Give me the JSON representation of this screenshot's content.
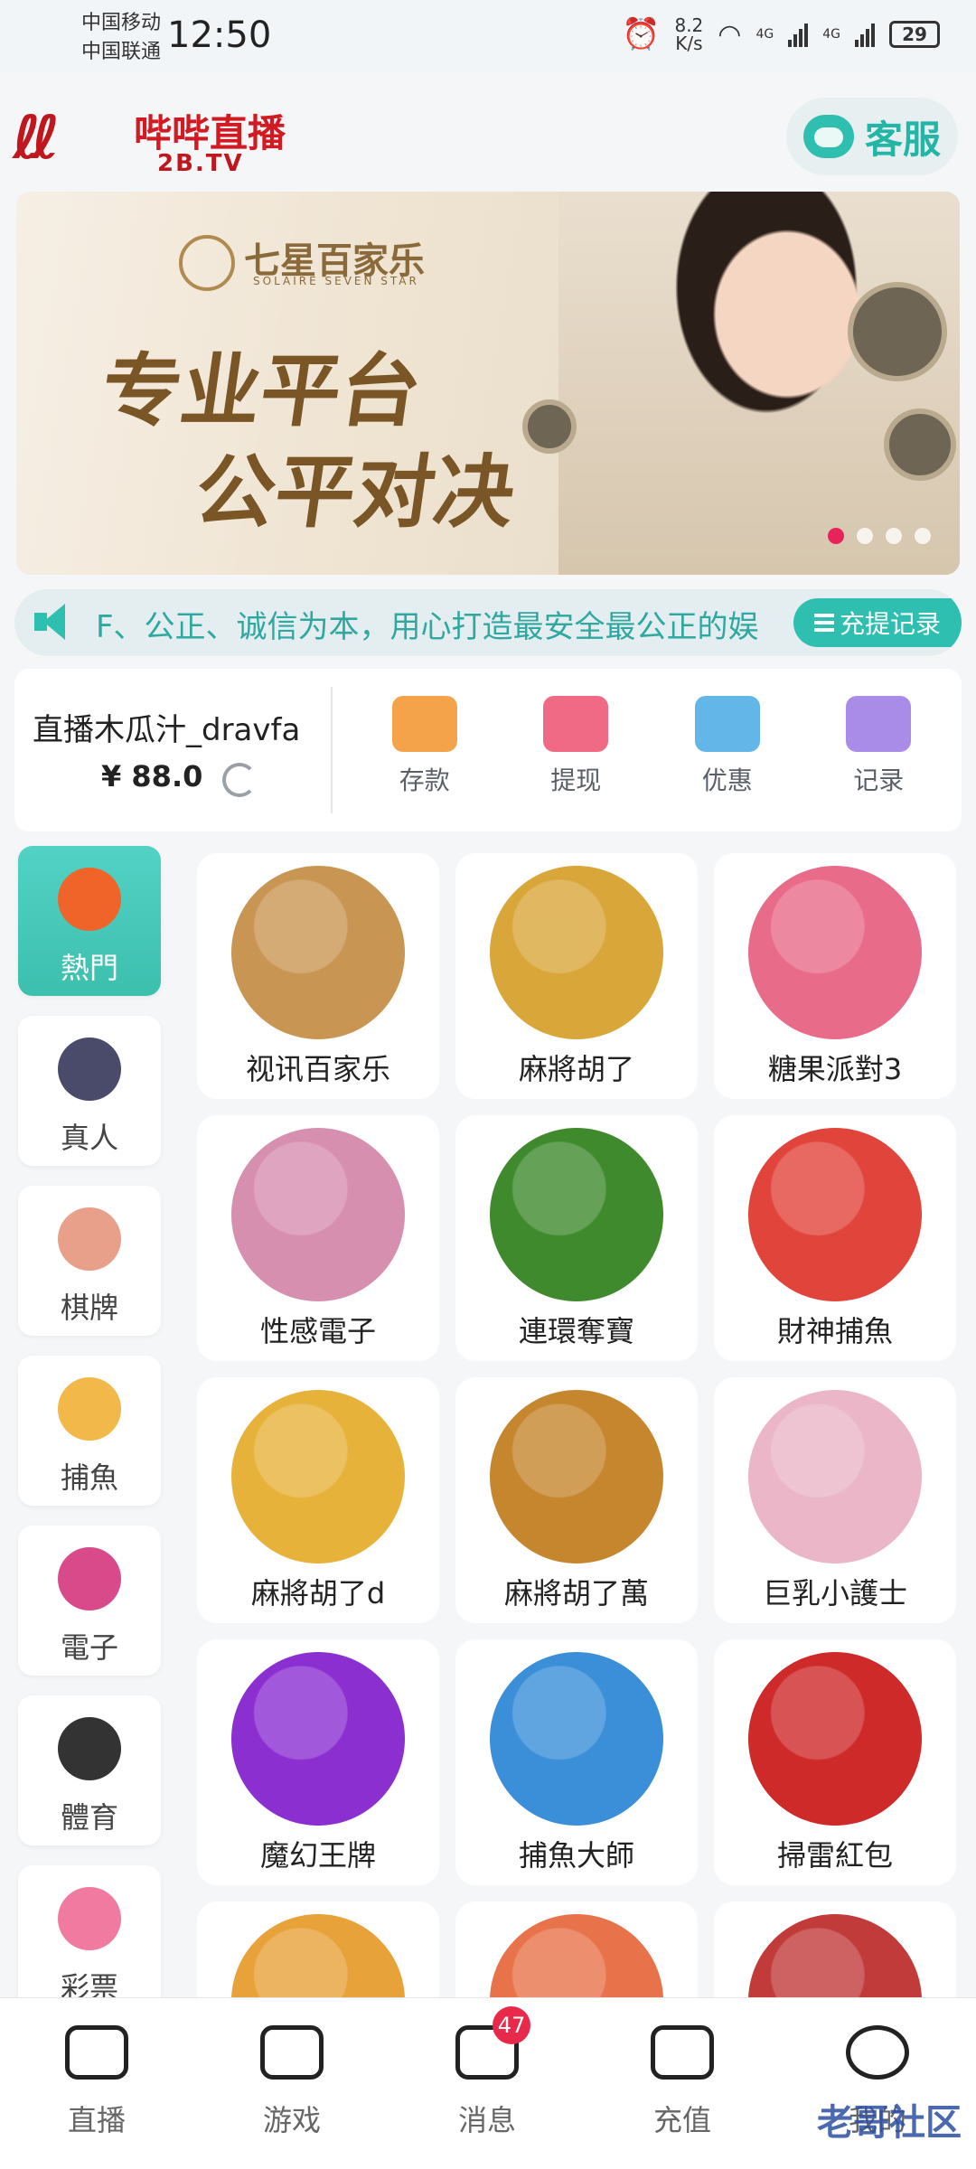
{
  "status_bar": {
    "carrier1": "中国移动",
    "carrier2": "中国联通",
    "time": "12:50",
    "speed_value": "8.2",
    "speed_unit": "K/s",
    "sig1": "4G",
    "sig2": "4G",
    "battery": "29"
  },
  "header": {
    "logo_title": "哔哔直播",
    "logo_sub": "2B.TV",
    "service_label": "客服"
  },
  "banner": {
    "brand": "七星百家乐",
    "brand_sub": "SOLAIRE SEVEN STAR",
    "line1": "专业平台",
    "line2": "公平对决",
    "dot_count": 4,
    "active_dot": 0
  },
  "notice": {
    "text": "F、公正、诚信为本，用心打造最安全最公正的娱",
    "records_label": "充提记录"
  },
  "wallet": {
    "username": "直播木瓜汁_dravfa",
    "balance": "¥ 88.0",
    "actions": [
      {
        "label": "存款",
        "icon": "wallet-icon",
        "color": "#f4a34a"
      },
      {
        "label": "提现",
        "icon": "withdraw-icon",
        "color": "#f06a86"
      },
      {
        "label": "优惠",
        "icon": "gift-icon",
        "color": "#62b6e8"
      },
      {
        "label": "记录",
        "icon": "folder-clock-icon",
        "color": "#a98be8"
      }
    ]
  },
  "sidebar": [
    {
      "label": "熱門",
      "icon": "flame-icon",
      "active": true
    },
    {
      "label": "真人",
      "icon": "poker-chip-icon",
      "active": false
    },
    {
      "label": "棋牌",
      "icon": "cards-icon",
      "active": false
    },
    {
      "label": "捕魚",
      "icon": "shark-icon",
      "active": false
    },
    {
      "label": "電子",
      "icon": "slot-icon",
      "active": false
    },
    {
      "label": "體育",
      "icon": "soccer-ball-icon",
      "active": false
    },
    {
      "label": "彩票",
      "icon": "lottery-ball-icon",
      "active": false
    }
  ],
  "games": [
    {
      "label": "视讯百家乐",
      "art": "#c99553"
    },
    {
      "label": "麻將胡了",
      "art": "#d9a63a"
    },
    {
      "label": "糖果派對3",
      "art": "#e96b8a"
    },
    {
      "label": "性感電子",
      "art": "#d78fb0"
    },
    {
      "label": "連環奪寶",
      "art": "#3f8a2c"
    },
    {
      "label": "財神捕魚",
      "art": "#e1443a"
    },
    {
      "label": "麻將胡了d",
      "art": "#e6b23a"
    },
    {
      "label": "麻將胡了萬",
      "art": "#c6862e"
    },
    {
      "label": "巨乳小護士",
      "art": "#eab6c8"
    },
    {
      "label": "魔幻王牌",
      "art": "#8b2fd1"
    },
    {
      "label": "捕魚大師",
      "art": "#3a8fd8"
    },
    {
      "label": "掃雷紅包",
      "art": "#cf2a2a"
    },
    {
      "label": "",
      "art": "#e8a23a"
    },
    {
      "label": "",
      "art": "#e8734a"
    },
    {
      "label": "",
      "art": "#c23b3b"
    }
  ],
  "bottom_nav": [
    {
      "label": "直播",
      "icon": "camera-icon"
    },
    {
      "label": "游戏",
      "icon": "gamepad-icon"
    },
    {
      "label": "消息",
      "icon": "chat-icon",
      "badge": "47"
    },
    {
      "label": "充值",
      "icon": "wallet-icon"
    },
    {
      "label": "我的",
      "icon": "smile-icon"
    }
  ],
  "watermark": "老哥社区",
  "colors": {
    "accent": "#2fbfb0",
    "brand": "#c0171f",
    "badge": "#e8294a"
  }
}
